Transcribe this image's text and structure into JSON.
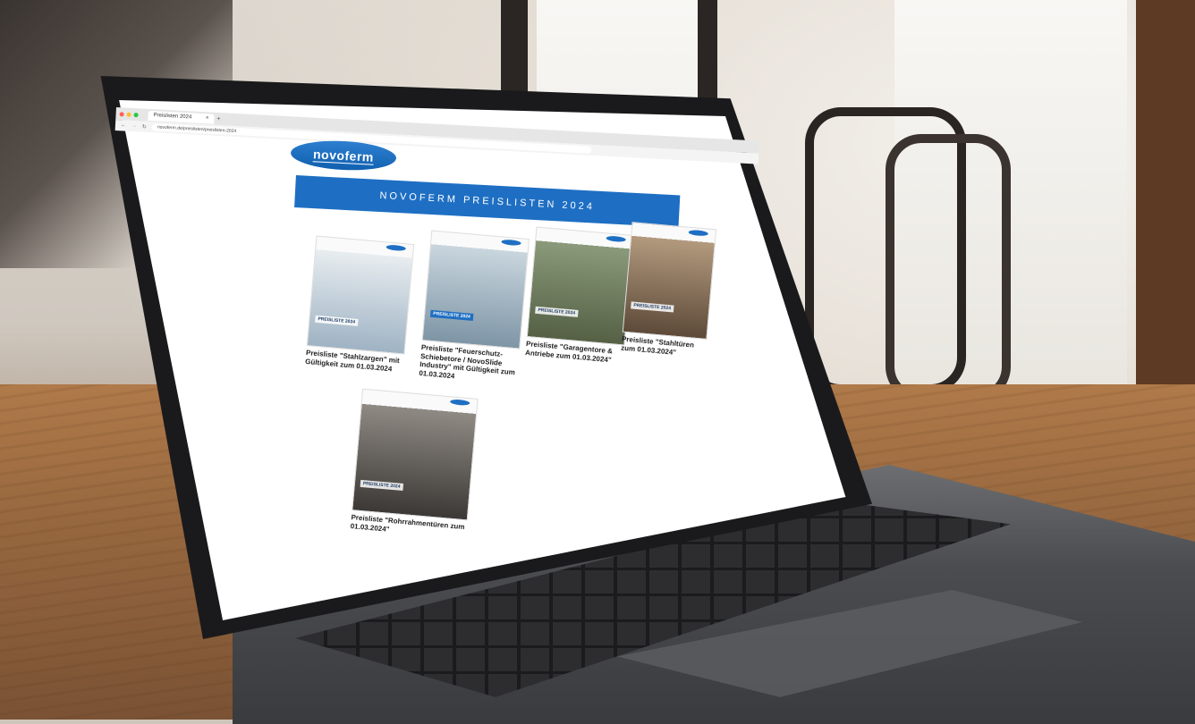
{
  "browser": {
    "tab_title": "Preislisten 2024",
    "tab_close": "×",
    "tab_new": "+",
    "url": "novoferm.de/preislisten/preislisten-2024"
  },
  "page": {
    "logo_text": "novoferm",
    "banner_title": "NOVOFERM PREISLISTEN 2024",
    "thumbnail_title": "PREISLISTE 2024"
  },
  "cards": [
    {
      "caption": "Preisliste \"Stahlzargen\" mit Gültigkeit zum 01.03.2024",
      "color_top": "#e8edf0",
      "color_bottom": "#9fb3c4"
    },
    {
      "caption": "Preisliste \"Feuerschutz-Schiebetore / NovoSlide Industry\" mit Gültigkeit zum 01.03.2024",
      "color_top": "#c9d6de",
      "color_bottom": "#7e95a6"
    },
    {
      "caption": "Preisliste \"Garagentore & Antriebe zum 01.03.2024\"",
      "color_top": "#8a9a7a",
      "color_bottom": "#556045"
    },
    {
      "caption": "Preisliste \"Stahltüren zum 01.03.2024\"",
      "color_top": "#b39a7e",
      "color_bottom": "#5d4a39"
    },
    {
      "caption": "Preisliste \"Rohrrahmentüren zum 01.03.2024\"",
      "color_top": "#8f8a84",
      "color_bottom": "#3c3835"
    }
  ],
  "colors": {
    "brand_blue": "#1e6fc3",
    "traffic_red": "#ff5f57",
    "traffic_yellow": "#febc2e",
    "traffic_green": "#28c840"
  }
}
